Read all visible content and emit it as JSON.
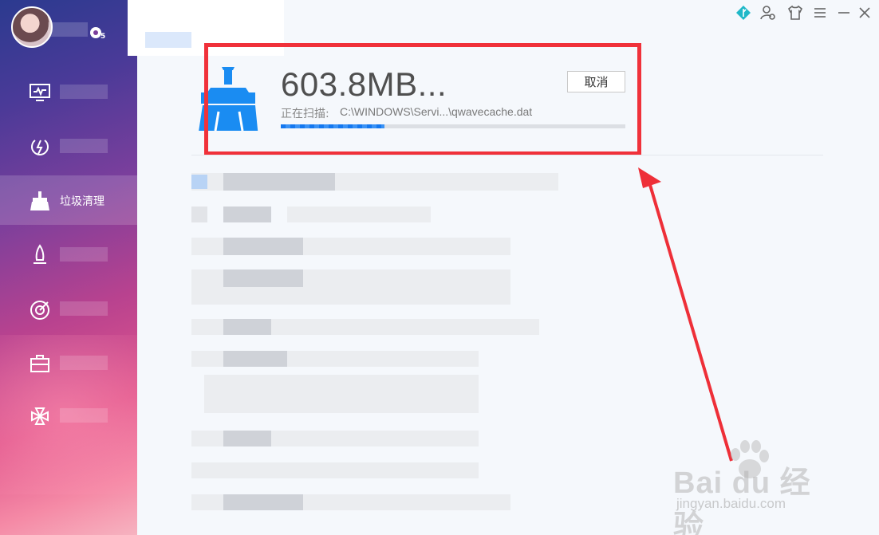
{
  "sidebar": {
    "items": [
      {
        "id": "checkup",
        "icon": "monitor-icon",
        "label": ""
      },
      {
        "id": "speed",
        "icon": "power-speed-icon",
        "label": ""
      },
      {
        "id": "cleanup",
        "icon": "broom-icon",
        "label": "垃圾清理",
        "active": true
      },
      {
        "id": "boost",
        "icon": "rocket-icon",
        "label": ""
      },
      {
        "id": "scan",
        "icon": "radar-icon",
        "label": ""
      },
      {
        "id": "toolbox",
        "icon": "toolbox-icon",
        "label": ""
      },
      {
        "id": "more",
        "icon": "clover-icon",
        "label": ""
      }
    ]
  },
  "titlebar": {
    "icons": [
      "leaf-icon",
      "user-settings-icon",
      "shirt-icon",
      "menu-icon",
      "minimize-icon",
      "close-icon"
    ]
  },
  "scan": {
    "size": "603.8MB...",
    "label": "正在扫描:",
    "path": "C:\\WINDOWS\\Servi...\\qwavecache.dat",
    "progress": 0.3,
    "cancel_label": "取消"
  },
  "watermark": {
    "brand": "Bai du 经验",
    "url": "jingyan.baidu.com"
  },
  "colors": {
    "accent": "#1478f0",
    "highlight": "#f0313a",
    "sidebar_top": "#2b3a8f",
    "sidebar_bottom": "#f58aa6"
  }
}
